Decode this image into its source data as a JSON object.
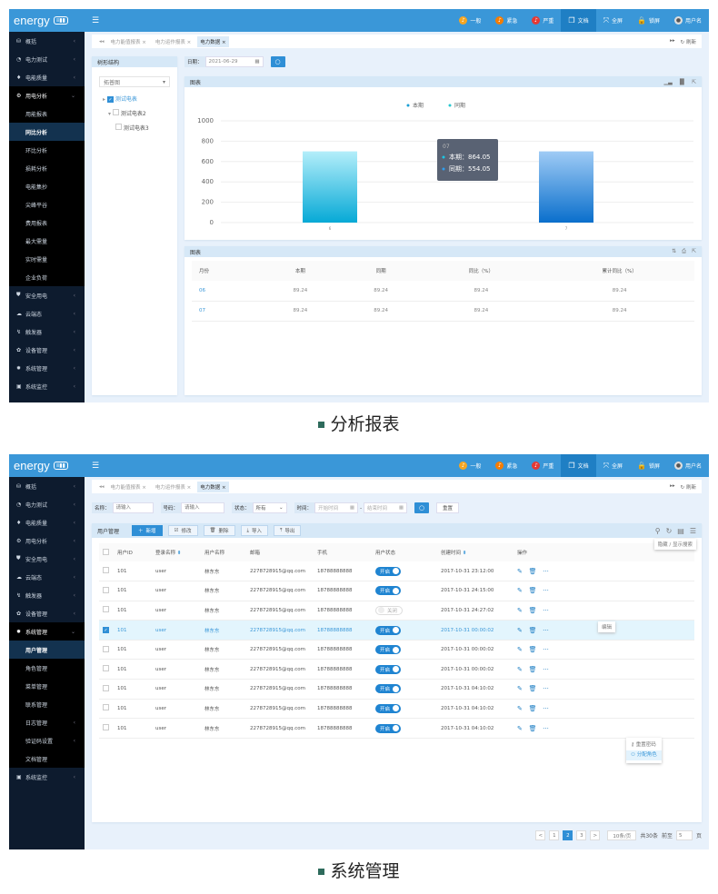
{
  "app": {
    "logo": "energy",
    "menu_icon": "hamburger-icon"
  },
  "header": {
    "items": [
      {
        "label": "一般",
        "icon": "bell-icon",
        "color": "#f5a623"
      },
      {
        "label": "紧急",
        "icon": "bell-icon",
        "color": "#f57c00"
      },
      {
        "label": "严重",
        "icon": "bell-icon",
        "color": "#e53935"
      },
      {
        "label": "文档",
        "icon": "document-icon",
        "active": true
      },
      {
        "label": "全屏",
        "icon": "fullscreen-icon"
      },
      {
        "label": "锁屏",
        "icon": "lock-icon"
      },
      {
        "label": "用户名",
        "icon": "avatar"
      }
    ]
  },
  "tabs": {
    "items": [
      "电力能值报表",
      "电力运作报表",
      "电力数据"
    ],
    "active": 2,
    "refresh": "刷新"
  },
  "screen1": {
    "sidebar": [
      {
        "label": "概括",
        "icon": "dashboard-icon",
        "chev": "<"
      },
      {
        "label": "电力测试",
        "icon": "gauge-icon",
        "chev": "<"
      },
      {
        "label": "电能质量",
        "icon": "bulb-icon",
        "chev": "<"
      },
      {
        "label": "用电分析",
        "icon": "analysis-icon",
        "chev": "v",
        "open": true
      },
      {
        "label": "用能报表",
        "sub": true
      },
      {
        "label": "同比分析",
        "sub": true,
        "active": true
      },
      {
        "label": "环比分析",
        "sub": true
      },
      {
        "label": "损耗分析",
        "sub": true
      },
      {
        "label": "电能集抄",
        "sub": true
      },
      {
        "label": "尖峰平谷",
        "sub": true
      },
      {
        "label": "费用报表",
        "sub": true
      },
      {
        "label": "最大需量",
        "sub": true
      },
      {
        "label": "实时需量",
        "sub": true
      },
      {
        "label": "企业负荷",
        "sub": true
      },
      {
        "label": "安全用电",
        "icon": "shield-icon",
        "chev": "<"
      },
      {
        "label": "云端态",
        "icon": "cloud-icon",
        "chev": "<"
      },
      {
        "label": "触发器",
        "icon": "trigger-icon",
        "chev": "<"
      },
      {
        "label": "设备管理",
        "icon": "device-icon",
        "chev": "<"
      },
      {
        "label": "系统管理",
        "icon": "gear-icon",
        "chev": "<"
      },
      {
        "label": "系统监控",
        "icon": "monitor-icon",
        "chev": "<"
      }
    ],
    "tree": {
      "title": "树形结构",
      "select": "拓普图",
      "nodes": [
        {
          "label": "测试电表",
          "checked": true
        },
        {
          "label": "测试电表2"
        },
        {
          "label": "测试电表3"
        }
      ]
    },
    "filter": {
      "date_label": "日期：",
      "date_value": "2021-06-29"
    },
    "chart_panel_title": "图表",
    "table_panel_title": "图表",
    "table": {
      "headers": [
        "月份",
        "本期",
        "同期",
        "同比（%）",
        "累计同比（%）"
      ],
      "rows": [
        [
          "06",
          "89.24",
          "89.24",
          "89.24",
          "89.24"
        ],
        [
          "07",
          "89.24",
          "89.24",
          "89.24",
          "89.24"
        ]
      ]
    },
    "caption": "分析报表"
  },
  "chart_data": {
    "type": "bar",
    "categories": [
      "6",
      "7"
    ],
    "ylim": [
      0,
      1000
    ],
    "yticks": [
      0,
      200,
      400,
      600,
      800,
      1000
    ],
    "grid": true,
    "legend_placement": "top-center",
    "series": [
      {
        "name": "本期",
        "color": "#1a9fd6",
        "values": [
          700,
          null
        ]
      },
      {
        "name": "同期",
        "color": "#28c8d0",
        "values": [
          null,
          700
        ]
      }
    ],
    "tooltip": {
      "title": "07",
      "lines": [
        "本期：864.05",
        "同期：554.05"
      ]
    }
  },
  "screen2": {
    "sidebar": [
      {
        "label": "概括",
        "icon": "dashboard-icon",
        "chev": "<"
      },
      {
        "label": "电力测试",
        "icon": "gauge-icon",
        "chev": "<"
      },
      {
        "label": "电能质量",
        "icon": "bulb-icon",
        "chev": "<"
      },
      {
        "label": "用电分析",
        "icon": "analysis-icon",
        "chev": "<"
      },
      {
        "label": "安全用电",
        "icon": "shield-icon",
        "chev": "<"
      },
      {
        "label": "云端态",
        "icon": "cloud-icon",
        "chev": "<"
      },
      {
        "label": "触发器",
        "icon": "trigger-icon",
        "chev": "<"
      },
      {
        "label": "设备管理",
        "icon": "device-icon",
        "chev": "<"
      },
      {
        "label": "系统管理",
        "icon": "gear-icon",
        "chev": "v",
        "open": true
      },
      {
        "label": "用户管理",
        "sub": true,
        "active": true
      },
      {
        "label": "角色管理",
        "sub": true
      },
      {
        "label": "菜单管理",
        "sub": true
      },
      {
        "label": "联系管理",
        "sub": true
      },
      {
        "label": "日志管理",
        "sub": true,
        "chev": "<"
      },
      {
        "label": "验证码设置",
        "sub": true,
        "chev": "<"
      },
      {
        "label": "文档管理",
        "sub": true
      },
      {
        "label": "系统监控",
        "icon": "monitor-icon",
        "chev": "<"
      }
    ],
    "filters": {
      "name_label": "名称：",
      "name_placeholder": "请输入",
      "code_label": "号码：",
      "code_placeholder": "请输入",
      "status_label": "状态：",
      "status_value": "所有",
      "time_label": "时间：",
      "start_placeholder": "开始时间",
      "end_placeholder": "结束时间",
      "reset": "重置"
    },
    "panel_title": "用户管理",
    "actions": [
      "新增",
      "修改",
      "删除",
      "导入",
      "导出"
    ],
    "search_tooltip": "隐藏 / 显示搜索",
    "headers": [
      "用户ID",
      "登录名称",
      "用户名称",
      "邮箱",
      "手机",
      "用户状态",
      "创建时间",
      "操作"
    ],
    "rows": [
      {
        "id": "101",
        "login": "user",
        "name": "林东东",
        "email": "2278728915@qq.com",
        "phone": "18788888888",
        "status": "开启",
        "on": true,
        "time": "2017-10-31  23:12:00"
      },
      {
        "id": "101",
        "login": "user",
        "name": "林东东",
        "email": "2278728915@qq.com",
        "phone": "18788888888",
        "status": "开启",
        "on": true,
        "time": "2017-10-31  24:15:00"
      },
      {
        "id": "101",
        "login": "user",
        "name": "林东东",
        "email": "2278728915@qq.com",
        "phone": "18788888888",
        "status": "关闭",
        "on": false,
        "time": "2017-10-31  24:27:02"
      },
      {
        "id": "101",
        "login": "user",
        "name": "林东东",
        "email": "2278728915@qq.com",
        "phone": "18788888888",
        "status": "开启",
        "on": true,
        "time": "2017-10-31  00:00:02",
        "selected": true
      },
      {
        "id": "101",
        "login": "user",
        "name": "林东东",
        "email": "2278728915@qq.com",
        "phone": "18788888888",
        "status": "开启",
        "on": true,
        "time": "2017-10-31  00:00:02"
      },
      {
        "id": "101",
        "login": "user",
        "name": "林东东",
        "email": "2278728915@qq.com",
        "phone": "18788888888",
        "status": "开启",
        "on": true,
        "time": "2017-10-31  00:00:02"
      },
      {
        "id": "101",
        "login": "user",
        "name": "林东东",
        "email": "2278728915@qq.com",
        "phone": "18788888888",
        "status": "开启",
        "on": true,
        "time": "2017-10-31  04:10:02"
      },
      {
        "id": "101",
        "login": "user",
        "name": "林东东",
        "email": "2278728915@qq.com",
        "phone": "18788888888",
        "status": "开启",
        "on": true,
        "time": "2017-10-31  04:10:02"
      },
      {
        "id": "101",
        "login": "user",
        "name": "林东东",
        "email": "2278728915@qq.com",
        "phone": "18788888888",
        "status": "开启",
        "on": true,
        "time": "2017-10-31  04:10:02"
      }
    ],
    "edit_tooltip": "编辑",
    "more_menu": [
      "重置密码",
      "分配角色"
    ],
    "pagination": {
      "pages": [
        "1",
        "2",
        "3"
      ],
      "current": "2",
      "page_size": "10条/页",
      "total": "共30条",
      "goto_label": "前至",
      "goto_value": "5",
      "page_suffix": "页"
    },
    "caption": "系统管理"
  }
}
